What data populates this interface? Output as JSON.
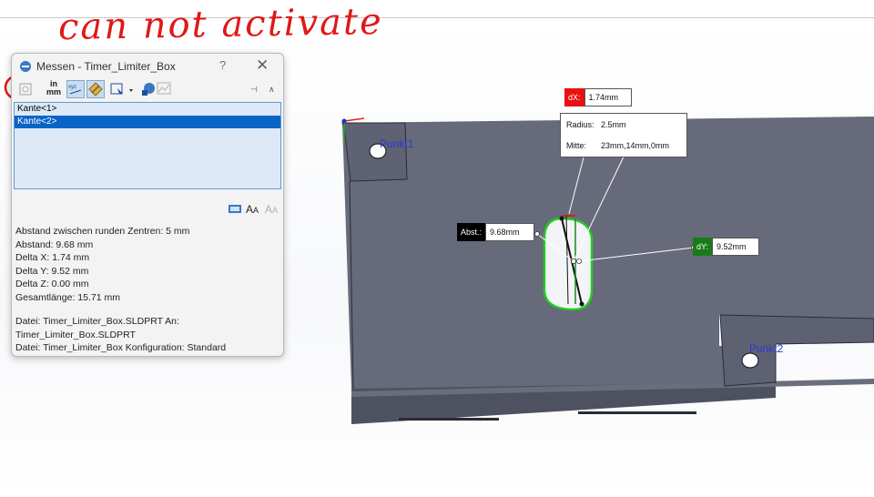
{
  "annotation": {
    "text": "can not activate",
    "color": "#e01818"
  },
  "dialog": {
    "title": "Messen - Timer_Limiter_Box",
    "help": "?",
    "close": "✕",
    "toolbar": {
      "units_label_top": "in",
      "units_label_bottom": "mm",
      "pin_label": "⊣",
      "collapse_label": "∧"
    },
    "selections": [
      {
        "label": "Kante<1>",
        "selected": false
      },
      {
        "label": "Kante<2>",
        "selected": true
      }
    ],
    "results": [
      "Abstand zwischen runden Zentren: 5 mm",
      "Abstand: 9.68 mm",
      "Delta X: 1.74 mm",
      "Delta Y: 9.52 mm",
      "Delta Z: 0.00 mm",
      "Gesamtlänge: 15.71 mm"
    ],
    "file_info": [
      "Datei: Timer_Limiter_Box.SLDPRT An:",
      "Timer_Limiter_Box.SLDPRT",
      "Datei: Timer_Limiter_Box Konfiguration: Standard"
    ]
  },
  "callouts": {
    "dx": {
      "key": "dX:",
      "value": "1.74mm",
      "color": "#e81010"
    },
    "dy": {
      "key": "dY:",
      "value": "9.52mm",
      "color": "#1a7a1a"
    },
    "abst": {
      "key": "Abst.:",
      "value": "9.68mm",
      "color": "#000000"
    },
    "radius_key": "Radius:",
    "radius_value": "2.5mm",
    "mitte_key": "Mitte:",
    "mitte_value": "23mm,14mm,0mm"
  },
  "points": {
    "p1": "Punkt1",
    "p2": "Punkt2"
  },
  "colors": {
    "part_face": "#676a7a",
    "part_side": "#4f5262",
    "highlight": "#22cc22",
    "accent": "#0a64c8"
  }
}
